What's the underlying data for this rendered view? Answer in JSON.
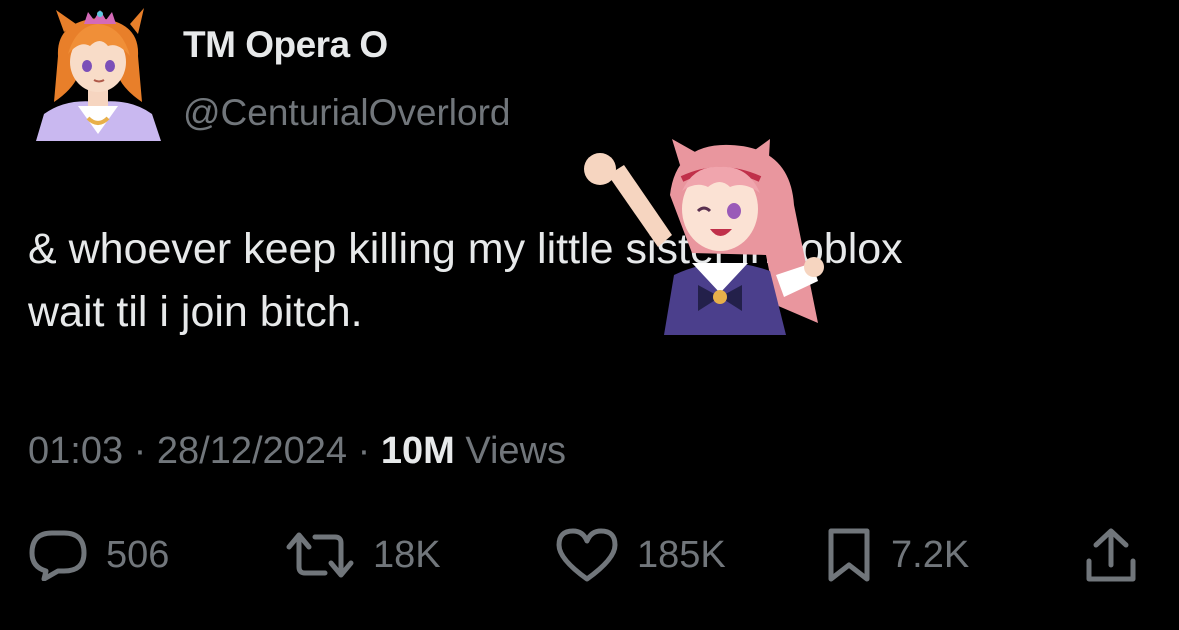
{
  "author": {
    "display_name": "TM Opera O",
    "handle": "@CenturialOverlord",
    "avatar_icon": "anime-avatar-icon"
  },
  "tweet": {
    "lines": [
      "& whoever keep killing my little sister in roblox",
      "wait til i join bitch."
    ],
    "sticker_icon": "anime-girl-sticker-icon"
  },
  "meta": {
    "time": "01:03",
    "separator": "·",
    "date": "28/12/2024",
    "views_count": "10M",
    "views_label": "Views"
  },
  "actions": {
    "replies": "506",
    "reposts": "18K",
    "likes": "185K",
    "bookmarks": "7.2K",
    "icons": [
      "reply-icon",
      "repost-icon",
      "like-icon",
      "bookmark-icon",
      "share-icon"
    ]
  },
  "colors": {
    "background": "#000000",
    "primary_text": "#e7e9ea",
    "secondary_text": "#71767b"
  }
}
